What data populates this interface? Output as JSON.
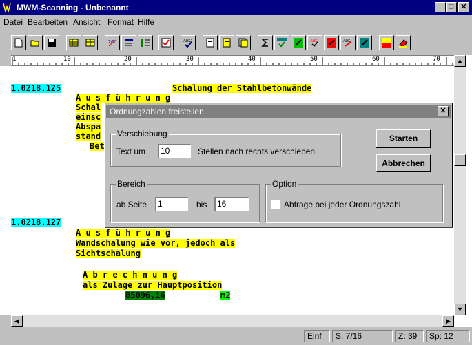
{
  "window": {
    "title": "MWM-Scanning - Unbenannt",
    "min_label": "_",
    "max_label": "□",
    "close_label": "✕"
  },
  "menu": {
    "items": [
      "Datei",
      "Bearbeiten",
      "Ansicht",
      "Format",
      "Hilfe"
    ]
  },
  "toolbar": {
    "buttons": [
      "new-document",
      "open-folder",
      "save-disk",
      "table-insert",
      "table-edit",
      "ordinal-numbers",
      "number-format",
      "list-format",
      "checklist",
      "spell-check",
      "page-view-1",
      "page-view-2",
      "page-view-3",
      "sum-symbol",
      "number-check",
      "mark-green",
      "abc-check",
      "mark-red",
      "abc-mark",
      "mark-blue",
      "ktz-tool",
      "eraser-tool"
    ]
  },
  "ruler": {
    "labels": [
      "1",
      "10",
      "20",
      "30",
      "40",
      "50",
      "60",
      "70"
    ]
  },
  "document": {
    "pos1_number": "1.0218.125",
    "pos1_title": "Schalung der Stahlbetonwände",
    "pos1_heading": "A u s f ü h r u n g",
    "pos1_frag1": "Schal",
    "pos1_frag2": "einsc",
    "pos1_frag3": "Abspa",
    "pos1_frag4": "stand",
    "pos1_frag5": "Bet",
    "pos2_number": "1.0218.127",
    "pos2_heading": "A u s f ü h r u n g",
    "pos2_line1": "Wandschalung wie vor, jedoch als",
    "pos2_line2": "Sichtschalung",
    "calc_heading": "A b r e c h n u n g",
    "calc_line": "als Zulage zur Hauptposition",
    "calc_value": "85096,16",
    "calc_unit": "m2"
  },
  "statusbar": {
    "mode": "Einf",
    "page": "S: 7/16",
    "line": "Z: 39",
    "column": "Sp: 12"
  },
  "dialog": {
    "title": "Ordnungzahlen freistellen",
    "close_label": "✕",
    "shift_group": "Verschiebung",
    "shift_prefix": "Text um",
    "shift_value": "10",
    "shift_suffix": "Stellen nach rechts verschieben",
    "range_group": "Bereich",
    "range_from_label": "ab Seite",
    "range_from_value": "1",
    "range_to_label": "bis",
    "range_to_value": "16",
    "option_group": "Option",
    "option_label": "Abfrage bei jeder Ordnungszahl",
    "option_checked": false,
    "start_button": "Starten",
    "cancel_button": "Abbrechen"
  }
}
